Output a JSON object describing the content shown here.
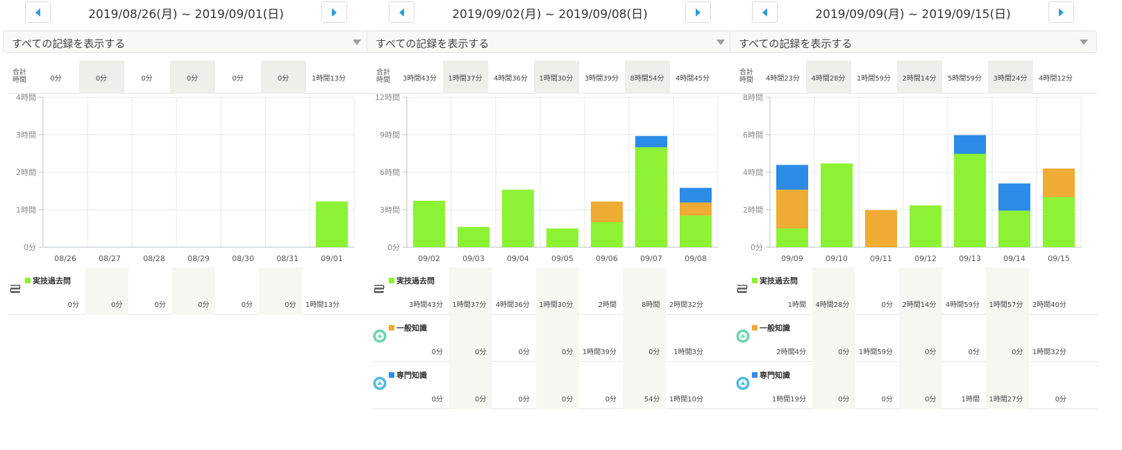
{
  "colors": {
    "past": "#8df234",
    "general": "#efab33",
    "special": "#2d8ce6",
    "nav": "#2a9bd8"
  },
  "legend": [
    {
      "key": "past",
      "label": "実技過去問",
      "icon": "book-stack-icon"
    },
    {
      "key": "general",
      "label": "一般知識",
      "icon": "globe-badge-icon"
    },
    {
      "key": "special",
      "label": "専門知識",
      "icon": "tech-badge-icon"
    }
  ],
  "panels": [
    {
      "date_range": "2019/08/26(月) ~ 2019/09/01(日)",
      "filter": "すべての記録を表示する",
      "totals_label": [
        "合計",
        "時間"
      ],
      "totals": [
        "0分",
        "0分",
        "0分",
        "0分",
        "0分",
        "0分",
        "1時間13分"
      ],
      "chart_data": {
        "type": "bar",
        "categories": [
          "08/26",
          "08/27",
          "08/28",
          "08/29",
          "08/30",
          "08/31",
          "09/01"
        ],
        "ylim": [
          0,
          4
        ],
        "yticks": [
          "0分",
          "1時間",
          "2時間",
          "3時間",
          "4時間"
        ],
        "series": [
          {
            "name": "実技過去問",
            "values": [
              0,
              0,
              0,
              0,
              0,
              0,
              1.22
            ]
          }
        ]
      },
      "legend_rows": [
        {
          "values": [
            "0分",
            "0分",
            "0分",
            "0分",
            "0分",
            "0分",
            "1時間13分"
          ]
        }
      ]
    },
    {
      "date_range": "2019/09/02(月) ~ 2019/09/08(日)",
      "filter": "すべての記録を表示する",
      "totals_label": [
        "合計",
        "時間"
      ],
      "totals": [
        "3時間43分",
        "1時間37分",
        "4時間36分",
        "1時間30分",
        "3時間39分",
        "8時間54分",
        "4時間45分"
      ],
      "chart_data": {
        "type": "bar",
        "categories": [
          "09/02",
          "09/03",
          "09/04",
          "09/05",
          "09/06",
          "09/07",
          "09/08"
        ],
        "ylim": [
          0,
          12
        ],
        "yticks": [
          "0分",
          "3時間",
          "6時間",
          "9時間",
          "12時間"
        ],
        "series": [
          {
            "name": "実技過去問",
            "values": [
              3.72,
              1.62,
              4.6,
              1.5,
              2.0,
              8.0,
              2.53
            ]
          },
          {
            "name": "一般知識",
            "values": [
              0,
              0,
              0,
              0,
              0,
              0,
              0,
              1.65,
              0,
              1.05
            ]
          },
          {
            "name": "専門知識",
            "values": [
              0,
              0,
              0,
              0,
              0,
              0.9,
              1.17
            ]
          }
        ]
      },
      "legend_rows": [
        {
          "values": [
            "3時間43分",
            "1時間37分",
            "4時間36分",
            "1時間30分",
            "2時間",
            "8時間",
            "2時間32分"
          ]
        },
        {
          "values": [
            "0分",
            "0分",
            "0分",
            "0分",
            "1時間39分",
            "0分",
            "1時間3分"
          ]
        },
        {
          "values": [
            "0分",
            "0分",
            "0分",
            "0分",
            "0分",
            "54分",
            "1時間10分"
          ]
        }
      ]
    },
    {
      "date_range": "2019/09/09(月) ~ 2019/09/15(日)",
      "filter": "すべての記録を表示する",
      "totals_label": [
        "合計",
        "時間"
      ],
      "totals": [
        "4時間23分",
        "4時間28分",
        "1時間59分",
        "2時間14分",
        "5時間59分",
        "3時間24分",
        "4時間12分"
      ],
      "chart_data": {
        "type": "bar",
        "categories": [
          "09/09",
          "09/10",
          "09/11",
          "09/12",
          "09/13",
          "09/14",
          "09/15"
        ],
        "ylim": [
          0,
          8
        ],
        "yticks": [
          "0分",
          "2時間",
          "4時間",
          "6時間",
          "8時間"
        ],
        "series": [
          {
            "name": "実技過去問",
            "values": [
              1.0,
              4.47,
              0,
              2.23,
              4.98,
              1.95,
              2.67
            ]
          },
          {
            "name": "一般知識",
            "values": [
              2.07,
              0,
              1.98,
              0,
              0,
              0,
              1.53
            ]
          },
          {
            "name": "専門知識",
            "values": [
              1.32,
              0,
              0,
              0,
              1.0,
              1.45,
              0
            ]
          }
        ]
      },
      "legend_rows": [
        {
          "values": [
            "1時間",
            "4時間28分",
            "0分",
            "2時間14分",
            "4時間59分",
            "1時間57分",
            "2時間40分"
          ]
        },
        {
          "values": [
            "2時間4分",
            "0分",
            "1時間59分",
            "0分",
            "0分",
            "0分",
            "1時間32分"
          ]
        },
        {
          "values": [
            "1時間19分",
            "0分",
            "0分",
            "0分",
            "1時間",
            "1時間27分",
            "0分"
          ]
        }
      ]
    }
  ]
}
